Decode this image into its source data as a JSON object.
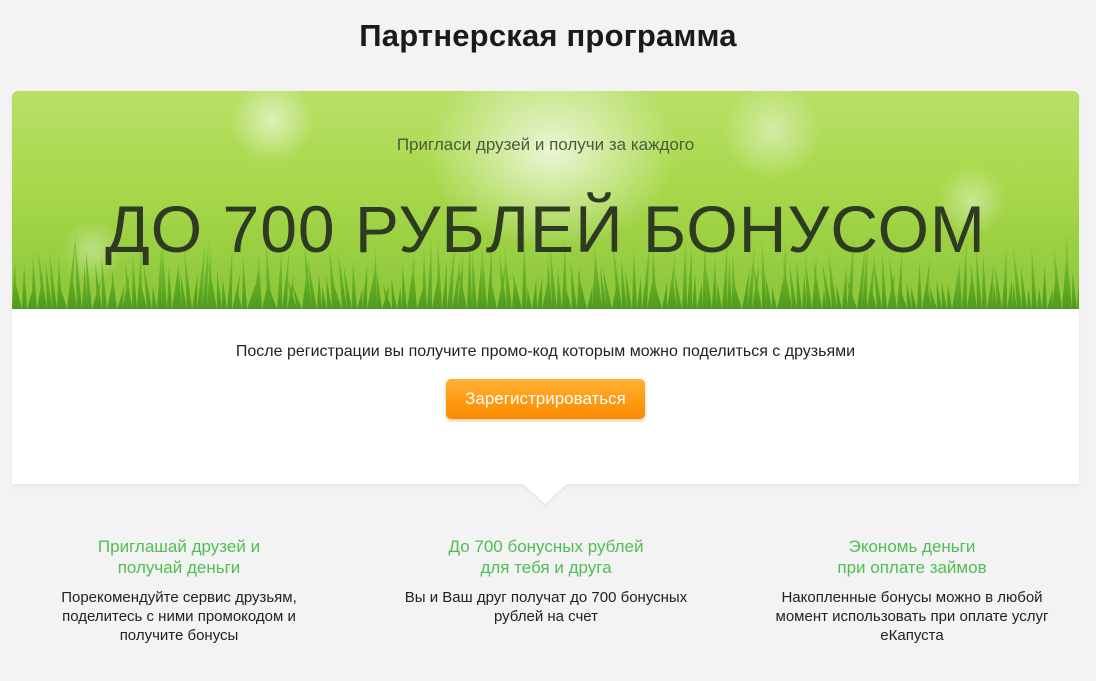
{
  "page": {
    "title": "Партнерская программа"
  },
  "hero": {
    "subtitle": "Пригласи друзей и получи за каждого",
    "headline": "ДО 700 РУБЛЕЙ БОНУСОМ"
  },
  "promo": {
    "text": "После регистрации вы получите промо-код которым можно поделиться с друзьями",
    "register_label": "Зарегистрироваться"
  },
  "features": [
    {
      "title": "Приглашай друзей и\nполучай деньги",
      "text": "Порекомендуйте сервис друзьям,\nподелитесь с ними промокодом и\nполучите бонусы"
    },
    {
      "title": "До 700 бонусных рублей\nдля тебя и друга",
      "text": "Вы и Ваш друг получат до 700 бонусных\nрублей на счет"
    },
    {
      "title": "Экономь деньги\nпри оплате займов",
      "text": "Накопленные бонусы можно в любой\nмомент использовать при оплате услуг\nеКапуста"
    }
  ],
  "colors": {
    "accent_green": "#4fbe55",
    "button_orange": "#ff9a10",
    "background": "#f3f3f3"
  }
}
